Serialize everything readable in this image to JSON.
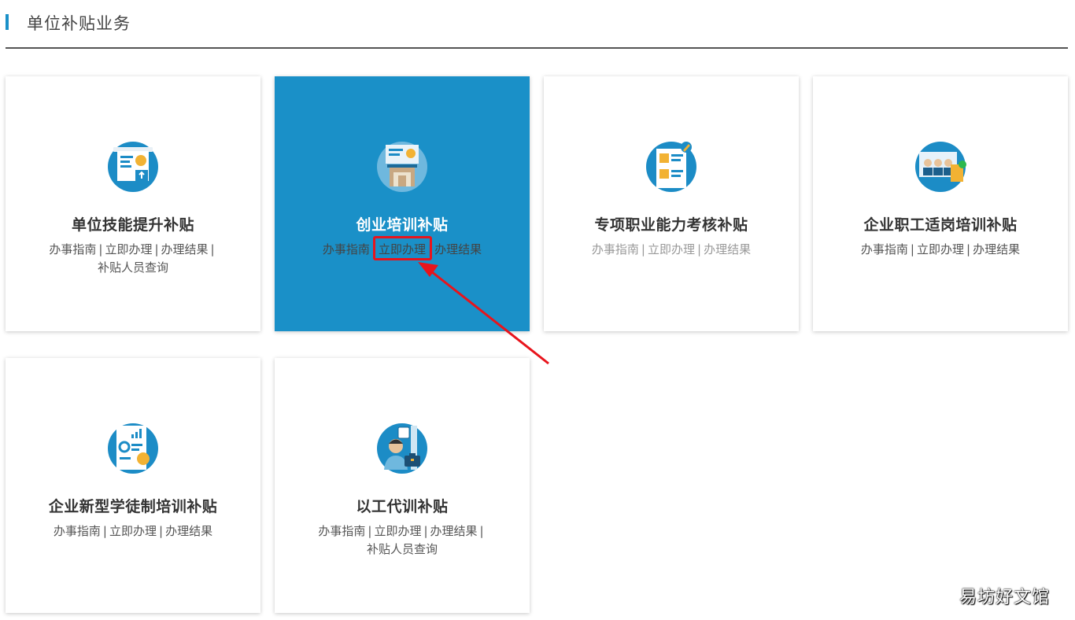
{
  "section": {
    "title": "单位补贴业务"
  },
  "colors": {
    "accent": "#1a90c8",
    "highlight": "#e8141c"
  },
  "cards": [
    {
      "name": "单位技能提升补贴",
      "icon": "presentation-board-icon",
      "links": [
        "办事指南",
        "立即办理",
        "办理结果",
        "补贴人员查询"
      ]
    },
    {
      "name": "创业培训补贴",
      "icon": "training-building-icon",
      "links": [
        "办事指南",
        "立即办理",
        "办理结果"
      ]
    },
    {
      "name": "专项职业能力考核补贴",
      "icon": "certificate-document-icon",
      "links": [
        "办事指南",
        "立即办理",
        "办理结果"
      ]
    },
    {
      "name": "企业职工适岗培训补贴",
      "icon": "staff-group-icon",
      "links": [
        "办事指南",
        "立即办理",
        "办理结果"
      ]
    },
    {
      "name": "企业新型学徒制培训补贴",
      "icon": "report-chart-icon",
      "links": [
        "办事指南",
        "立即办理",
        "办理结果"
      ]
    },
    {
      "name": "以工代训补贴",
      "icon": "job-recruit-icon",
      "links": [
        "办事指南",
        "立即办理",
        "办理结果",
        "补贴人员查询"
      ]
    }
  ],
  "watermark": "易坊好文馆"
}
